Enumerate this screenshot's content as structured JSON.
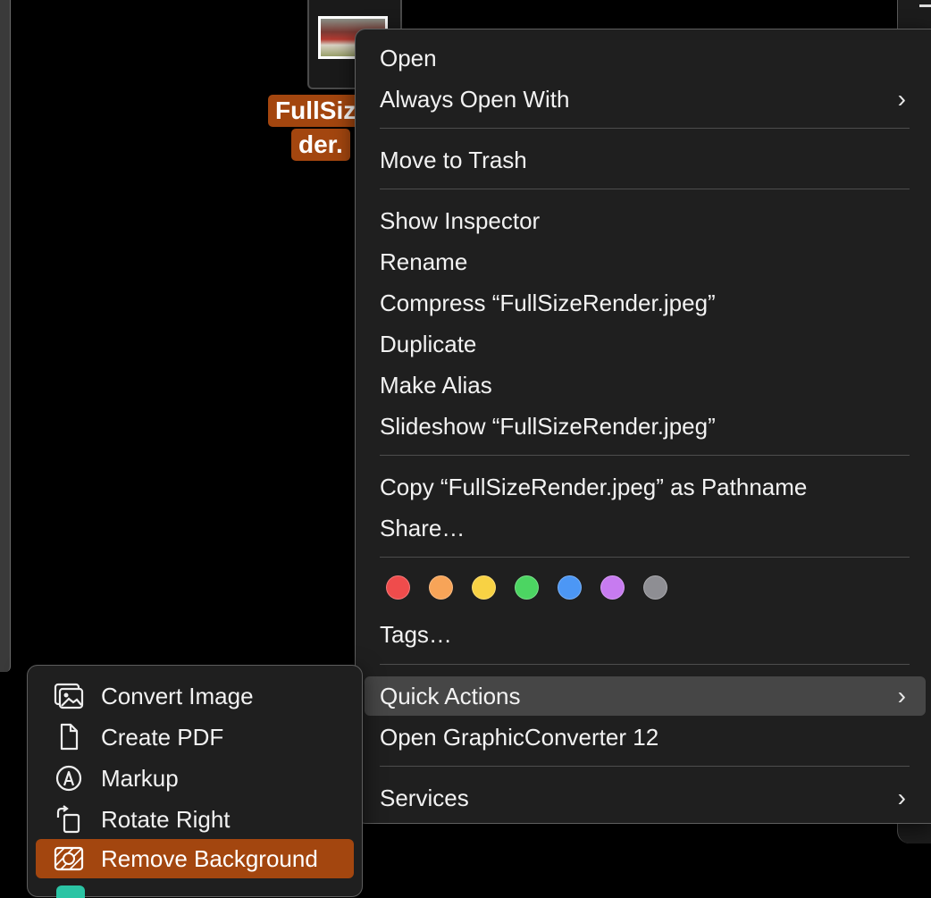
{
  "file": {
    "label_line1": "FullSiz",
    "label_line2": "der."
  },
  "context_menu": {
    "items": [
      {
        "label": "Open"
      },
      {
        "label": "Always Open With",
        "chevron": "›"
      },
      {
        "label": "Move to Trash"
      },
      {
        "label": "Show Inspector"
      },
      {
        "label": "Rename"
      },
      {
        "label": "Compress “FullSizeRender.jpeg”"
      },
      {
        "label": "Duplicate"
      },
      {
        "label": "Make Alias"
      },
      {
        "label": "Slideshow “FullSizeRender.jpeg”"
      },
      {
        "label": "Copy “FullSizeRender.jpeg” as Pathname"
      },
      {
        "label": "Share…"
      },
      {
        "label": "Tags…"
      },
      {
        "label": "Quick Actions",
        "chevron": "›"
      },
      {
        "label": "Open GraphicConverter 12"
      },
      {
        "label": "Services",
        "chevron": "›"
      }
    ],
    "tag_colors": [
      "#ef4c4c",
      "#f7a458",
      "#f8d244",
      "#4cd562",
      "#4c97f5",
      "#c77bf0",
      "#8e8e93"
    ]
  },
  "quick_actions": {
    "items": [
      {
        "label": "Convert Image",
        "icon": "image-stack-icon"
      },
      {
        "label": "Create PDF",
        "icon": "document-icon"
      },
      {
        "label": "Markup",
        "icon": "markup-pen-icon"
      },
      {
        "label": "Rotate Right",
        "icon": "rotate-right-icon"
      },
      {
        "label": "Remove Background",
        "icon": "remove-background-icon"
      }
    ],
    "selected_color": "#a3460f"
  }
}
